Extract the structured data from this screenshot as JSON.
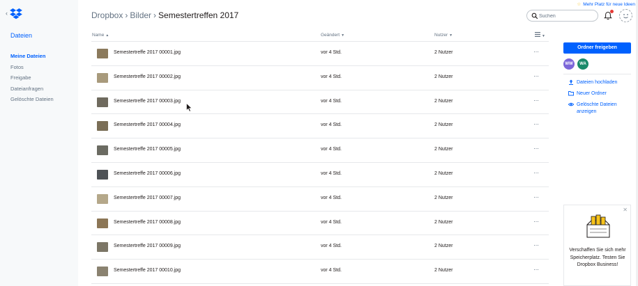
{
  "sidebar": {
    "title": "Dateien",
    "items": [
      {
        "label": "Meine Dateien"
      },
      {
        "label": "Fotos"
      },
      {
        "label": "Freigabe"
      },
      {
        "label": "Dateianfragen"
      },
      {
        "label": "Gelöschte Dateien"
      }
    ]
  },
  "header": {
    "breadcrumb": [
      "Dropbox",
      "Bilder",
      "Semestertreffen 2017"
    ],
    "upgrade_link": "Mehr Platz für neue Ideen",
    "search_placeholder": "Suchen"
  },
  "table": {
    "columns": {
      "name": "Name",
      "modified": "Geändert",
      "users": "Nutzer"
    },
    "rows": [
      {
        "name": "Semestertreffe 2017 00001.jpg",
        "modified": "vor 4 Std.",
        "users": "2 Nutzer",
        "thumb_color": "#8b7a5c"
      },
      {
        "name": "Semestertreffe 2017 00002.jpg",
        "modified": "vor 4 Std.",
        "users": "2 Nutzer",
        "thumb_color": "#a89a7c"
      },
      {
        "name": "Semestertreffe 2017 00003.jpg",
        "modified": "vor 4 Std.",
        "users": "2 Nutzer",
        "thumb_color": "#6f6a5e"
      },
      {
        "name": "Semestertreffe 2017 00004.jpg",
        "modified": "vor 4 Std.",
        "users": "2 Nutzer",
        "thumb_color": "#7a6e56"
      },
      {
        "name": "Semestertreffe 2017 00005.jpg",
        "modified": "vor 4 Std.",
        "users": "2 Nutzer",
        "thumb_color": "#6b6b62"
      },
      {
        "name": "Semestertreffe 2017 00006.jpg",
        "modified": "vor 4 Std.",
        "users": "2 Nutzer",
        "thumb_color": "#4e5256"
      },
      {
        "name": "Semestertreffe 2017 00007.jpg",
        "modified": "vor 4 Std.",
        "users": "2 Nutzer",
        "thumb_color": "#b5a88a"
      },
      {
        "name": "Semestertreffe 2017 00008.jpg",
        "modified": "vor 4 Std.",
        "users": "2 Nutzer",
        "thumb_color": "#8c7656"
      },
      {
        "name": "Semestertreffe 2017 00009.jpg",
        "modified": "vor 4 Std.",
        "users": "2 Nutzer",
        "thumb_color": "#7c7666"
      },
      {
        "name": "Semestertreffe 2017 00010.jpg",
        "modified": "vor 4 Std.",
        "users": "2 Nutzer",
        "thumb_color": "#8a8270"
      }
    ],
    "more_glyph": "···"
  },
  "right_panel": {
    "share_button": "Ordner freigeben",
    "members": [
      "WW",
      "WA"
    ],
    "actions": [
      {
        "label": "Dateien hochladen",
        "icon": "upload-icon"
      },
      {
        "label": "Neuer Ordner",
        "icon": "folder-icon"
      },
      {
        "label": "Gelöschte Dateien anzeigen",
        "icon": "eye-icon"
      }
    ],
    "promo_text": "Verschaffen Sie sich mehr Speicherplatz. Testen Sie Dropbox Business!"
  },
  "colors": {
    "accent": "#0061fe",
    "sidebar_bg": "#f7f9fa",
    "text_muted": "#637282"
  }
}
